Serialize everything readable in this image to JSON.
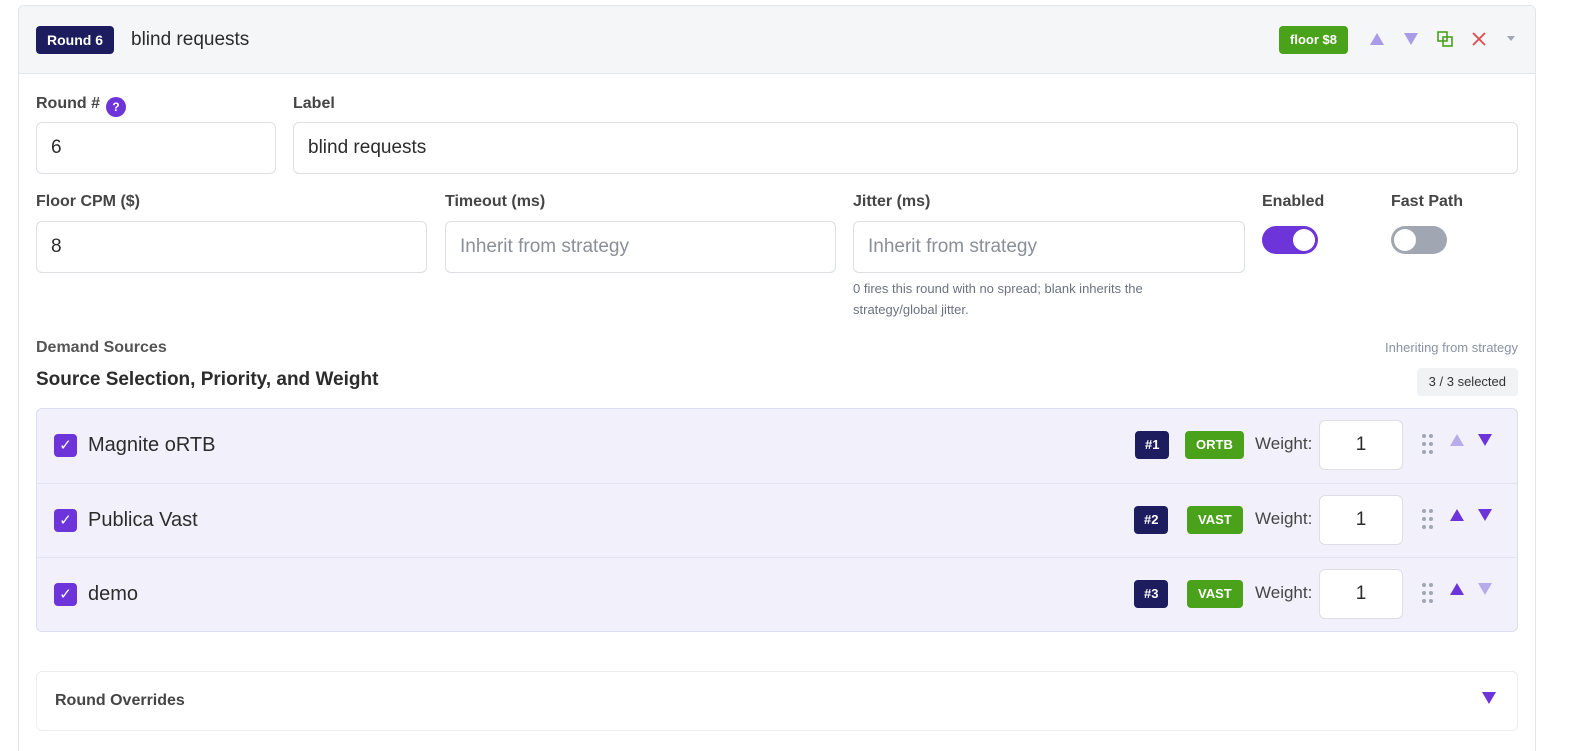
{
  "header": {
    "round_badge": "Round 6",
    "title": "blind requests",
    "floor_badge": "floor $8",
    "icons": [
      "move-up-icon",
      "move-down-icon",
      "duplicate-icon",
      "delete-icon",
      "collapse-icon"
    ]
  },
  "form": {
    "round_label": "Round #",
    "round_help": "?",
    "round_value": "6",
    "label_label": "Label",
    "label_value": "blind requests",
    "floor_label": "Floor CPM ($)",
    "floor_value": "8",
    "timeout_label": "Timeout (ms)",
    "timeout_placeholder": "Inherit from strategy",
    "jitter_label": "Jitter (ms)",
    "jitter_placeholder": "Inherit from strategy",
    "jitter_help": "0 fires this round with no spread; blank inherits the strategy/global jitter.",
    "enabled_label": "Enabled",
    "enabled": true,
    "fastpath_label": "Fast Path",
    "fastpath": false
  },
  "demand": {
    "section_label": "Demand Sources",
    "inherit_note": "Inheriting from strategy",
    "title": "Source Selection, Priority, and Weight",
    "selected_count": "3 / 3 selected",
    "weight_label": "Weight:",
    "sources": [
      {
        "name": "Magnite oRTB",
        "priority": "#1",
        "type": "ORTB",
        "weight": "1",
        "checked": true
      },
      {
        "name": "Publica Vast",
        "priority": "#2",
        "type": "VAST",
        "weight": "1",
        "checked": true
      },
      {
        "name": "demo",
        "priority": "#3",
        "type": "VAST",
        "weight": "1",
        "checked": true
      }
    ]
  },
  "overrides": {
    "title": "Round Overrides"
  },
  "colors": {
    "accent": "#6d35d9",
    "navy": "#1c1c5e",
    "green": "#4aa11a",
    "danger": "#e04848"
  },
  "check_glyph": "✓"
}
